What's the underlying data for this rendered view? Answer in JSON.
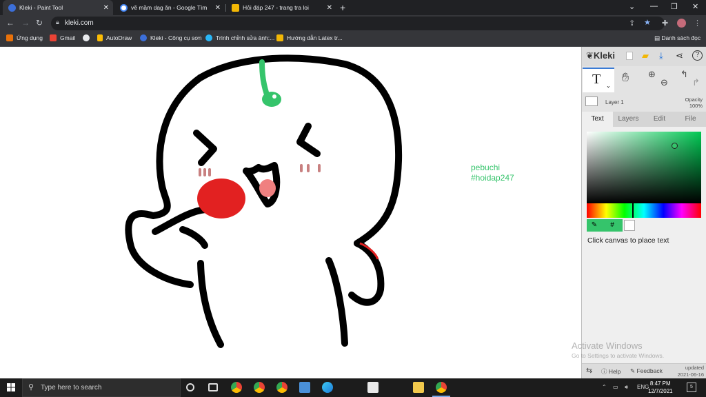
{
  "browser": {
    "tabs": [
      {
        "title": "Kleki - Paint Tool",
        "color": "#3c6fd9"
      },
      {
        "title": "vẽ mầm dag ăn - Google Tìm kiế",
        "color": "#4285f4"
      },
      {
        "title": "Hỏi đáp 247 - trang tra loi",
        "color": "#f2b705"
      }
    ],
    "url": "kleki.com",
    "bookmarks": [
      {
        "label": "Ứng dụng",
        "color": "#e8710a"
      },
      {
        "label": "Gmail",
        "color": "#ea4335"
      },
      {
        "label": "",
        "color": "#e8eaed"
      },
      {
        "label": "AutoDraw",
        "color": "#fbbc04"
      },
      {
        "label": "Kleki - Công cụ sơn",
        "color": "#3c6fd9"
      },
      {
        "label": "Trình chỉnh sửa ảnh:...",
        "color": "#29b6f6"
      },
      {
        "label": "Hướng dẫn Latex tr...",
        "color": "#f2b705"
      }
    ],
    "reading_list": "Danh sách đọc"
  },
  "canvas": {
    "text_line1": "pebuchi",
    "text_line2": "#hoidap247",
    "text_color": "#35c46b"
  },
  "panel": {
    "logo": "Kleki",
    "layer_name": "Layer 1",
    "opacity_label": "Opacity",
    "opacity_value": "100%",
    "tabs": [
      "Text",
      "Layers",
      "Edit",
      "File"
    ],
    "active_tab": "Text",
    "hint": "Click canvas to place text",
    "current_color": "#35c46b",
    "secondary_color": "#ffffff",
    "help_label": "Help",
    "feedback_label": "Feedback",
    "updated_label": "updated",
    "updated_date": "2021-06-16"
  },
  "watermark": {
    "line1": "Activate Windows",
    "line2": "Go to Settings to activate Windows."
  },
  "taskbar": {
    "search_placeholder": "Type here to search",
    "language": "ENG",
    "time": "8:47 PM",
    "date": "12/7/2021",
    "notifications": "5"
  }
}
